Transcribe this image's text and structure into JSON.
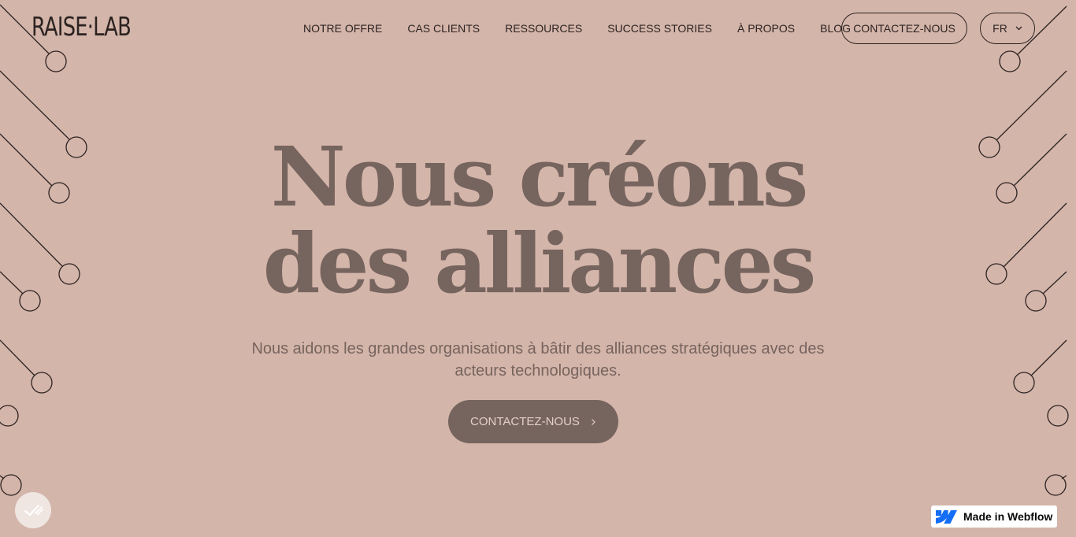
{
  "brand": {
    "logo_text": "RAISE·LAB"
  },
  "nav": {
    "items": [
      {
        "label": "NOTRE OFFRE"
      },
      {
        "label": "CAS CLIENTS"
      },
      {
        "label": "RESSOURCES"
      },
      {
        "label": "SUCCESS STORIES"
      },
      {
        "label": "À PROPOS"
      },
      {
        "label": "BLOG"
      }
    ],
    "contact_label": "CONTACTEZ-NOUS",
    "language": "FR"
  },
  "hero": {
    "title_line1": "Nous créons",
    "title_line2": "des alliances",
    "subtitle": "Nous aidons les grandes organisations à bâtir des alliances stratégiques avec des acteurs technologiques.",
    "cta_label": "CONTACTEZ-NOUS"
  },
  "badge": {
    "label": "Made in Webflow"
  },
  "icons": {
    "language_dropdown": "chevron-down-icon",
    "cta_arrow": "chevron-right-icon",
    "cookie": "cookie-check-icon",
    "webflow": "webflow-logo-icon"
  },
  "colors": {
    "background": "#d4b5aa",
    "text_dark": "#2c2321",
    "hero_text": "#76645e",
    "cta_bg": "#76645e",
    "cta_text": "#e3cfc7"
  }
}
